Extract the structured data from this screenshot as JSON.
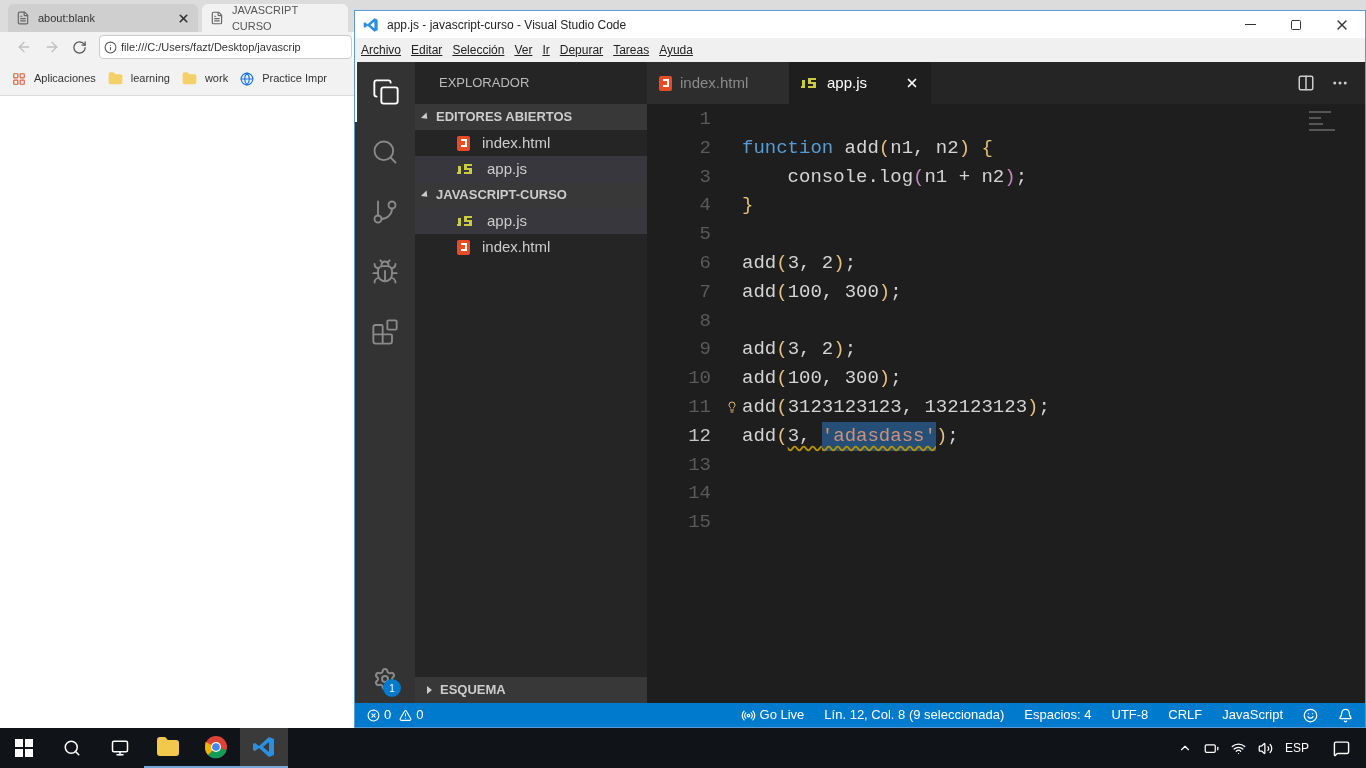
{
  "browser": {
    "tabs": [
      {
        "label": "about:blank",
        "selected": false
      },
      {
        "label": "JAVASCRIPT CURSO",
        "selected": true
      }
    ],
    "address": "file:///C:/Users/fazt/Desktop/javascrip",
    "bookmarks": [
      {
        "label": "Aplicaciones",
        "kind": "apps"
      },
      {
        "label": "learning",
        "kind": "folder"
      },
      {
        "label": "work",
        "kind": "folder"
      },
      {
        "label": "Practice Impr",
        "kind": "site"
      }
    ]
  },
  "vscode": {
    "title": "app.js - javascript-curso - Visual Studio Code",
    "menu": [
      "Archivo",
      "Editar",
      "Selección",
      "Ver",
      "Ir",
      "Depurar",
      "Tareas",
      "Ayuda"
    ],
    "activity": [
      {
        "kind": "files",
        "selected": true
      },
      {
        "kind": "search",
        "selected": false
      },
      {
        "kind": "git",
        "selected": false
      },
      {
        "kind": "debug",
        "selected": false
      },
      {
        "kind": "extensions",
        "selected": false
      }
    ],
    "settings_badge": "1",
    "sidebar": {
      "title": "EXPLORADOR",
      "sections": [
        {
          "title": "EDITORES ABIERTOS",
          "expanded": true,
          "files": [
            {
              "name": "index.html",
              "kind": "html",
              "selected": false
            },
            {
              "name": "app.js",
              "kind": "js",
              "selected": true
            }
          ]
        },
        {
          "title": "JAVASCRIPT-CURSO",
          "expanded": true,
          "files": [
            {
              "name": "app.js",
              "kind": "js",
              "selected": true
            },
            {
              "name": "index.html",
              "kind": "html",
              "selected": false
            }
          ]
        }
      ],
      "footer": {
        "title": "ESQUEMA",
        "expanded": false
      }
    },
    "tabs": [
      {
        "label": "index.html",
        "kind": "html",
        "selected": false
      },
      {
        "label": "app.js",
        "kind": "js",
        "selected": true
      }
    ],
    "code": [
      {
        "number": "1",
        "current": false
      },
      {
        "number": "2",
        "current": false,
        "tokens": [
          {
            "text": "function",
            "kind": "keyword"
          },
          {
            "text": " add",
            "kind": "name"
          },
          {
            "text": "(",
            "kind": "bracket"
          },
          {
            "text": "n1, n2",
            "kind": "name"
          },
          {
            "text": ")",
            "kind": "bracket"
          },
          {
            "text": " {",
            "kind": "bracket"
          }
        ]
      },
      {
        "number": "3",
        "current": false,
        "tokens": [
          {
            "text": "    console.log",
            "kind": "name"
          },
          {
            "text": "(",
            "kind": "paren"
          },
          {
            "text": "n1 + n2",
            "kind": "name"
          },
          {
            "text": ")",
            "kind": "paren"
          },
          {
            "text": ";",
            "kind": "name"
          }
        ]
      },
      {
        "number": "4",
        "current": false,
        "tokens": [
          {
            "text": "}",
            "kind": "bracket"
          }
        ]
      },
      {
        "number": "5",
        "current": false
      },
      {
        "number": "6",
        "current": false,
        "tokens": [
          {
            "text": "add",
            "kind": "name"
          },
          {
            "text": "(",
            "kind": "bracket"
          },
          {
            "text": "3, 2",
            "kind": "name"
          },
          {
            "text": ")",
            "kind": "bracket"
          },
          {
            "text": ";",
            "kind": "name"
          }
        ]
      },
      {
        "number": "7",
        "current": false,
        "tokens": [
          {
            "text": "add",
            "kind": "name"
          },
          {
            "text": "(",
            "kind": "bracket"
          },
          {
            "text": "100, 300",
            "kind": "name"
          },
          {
            "text": ")",
            "kind": "bracket"
          },
          {
            "text": ";",
            "kind": "name"
          }
        ]
      },
      {
        "number": "8",
        "current": false
      },
      {
        "number": "9",
        "current": false,
        "tokens": [
          {
            "text": "add",
            "kind": "name"
          },
          {
            "text": "(",
            "kind": "bracket"
          },
          {
            "text": "3, 2",
            "kind": "name"
          },
          {
            "text": ")",
            "kind": "bracket"
          },
          {
            "text": ";",
            "kind": "name"
          }
        ]
      },
      {
        "number": "10",
        "current": false,
        "tokens": [
          {
            "text": "add",
            "kind": "name"
          },
          {
            "text": "(",
            "kind": "bracket"
          },
          {
            "text": "100, 300",
            "kind": "name"
          },
          {
            "text": ")",
            "kind": "bracket"
          },
          {
            "text": ";",
            "kind": "name"
          }
        ]
      },
      {
        "number": "11",
        "current": false,
        "lightbulb": true,
        "tokens": [
          {
            "text": "add",
            "kind": "name"
          },
          {
            "text": "(",
            "kind": "bracket"
          },
          {
            "text": "3123123123, 132123123",
            "kind": "name"
          },
          {
            "text": ")",
            "kind": "bracket"
          },
          {
            "text": ";",
            "kind": "name"
          }
        ]
      },
      {
        "number": "12",
        "current": true,
        "tokens": [
          {
            "text": "add",
            "kind": "name"
          },
          {
            "text": "(",
            "kind": "bracket"
          },
          {
            "text": "3, ",
            "kind": "name",
            "warning": true
          },
          {
            "text": "'adasdass'",
            "kind": "string",
            "selected": true,
            "warning": true
          },
          {
            "text": ")",
            "kind": "bracket"
          },
          {
            "text": ";",
            "kind": "name"
          }
        ]
      },
      {
        "number": "13",
        "current": false
      },
      {
        "number": "14",
        "current": false
      },
      {
        "number": "15",
        "current": false
      }
    ],
    "status": {
      "errors": "0",
      "warnings": "0",
      "items": [
        {
          "label": "Go Live",
          "kind": "golive"
        },
        {
          "label": "Lín. 12, Col. 8 (9 seleccionada)",
          "kind": "text"
        },
        {
          "label": "Espacios: 4",
          "kind": "text"
        },
        {
          "label": "UTF-8",
          "kind": "text"
        },
        {
          "label": "CRLF",
          "kind": "text"
        },
        {
          "label": "JavaScript",
          "kind": "text"
        }
      ]
    }
  },
  "taskbar": {
    "apps": [
      {
        "kind": "files",
        "selected": false
      },
      {
        "kind": "chrome",
        "selected": false
      },
      {
        "kind": "vscode",
        "selected": true
      }
    ],
    "language": "ESP"
  }
}
